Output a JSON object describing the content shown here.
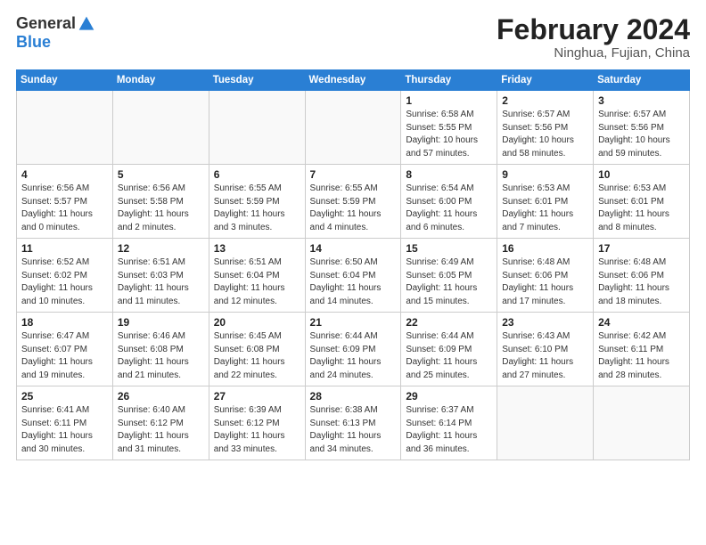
{
  "header": {
    "logo_general": "General",
    "logo_blue": "Blue",
    "main_title": "February 2024",
    "subtitle": "Ninghua, Fujian, China"
  },
  "weekdays": [
    "Sunday",
    "Monday",
    "Tuesday",
    "Wednesday",
    "Thursday",
    "Friday",
    "Saturday"
  ],
  "weeks": [
    [
      {
        "num": "",
        "info": ""
      },
      {
        "num": "",
        "info": ""
      },
      {
        "num": "",
        "info": ""
      },
      {
        "num": "",
        "info": ""
      },
      {
        "num": "1",
        "info": "Sunrise: 6:58 AM\nSunset: 5:55 PM\nDaylight: 10 hours\nand 57 minutes."
      },
      {
        "num": "2",
        "info": "Sunrise: 6:57 AM\nSunset: 5:56 PM\nDaylight: 10 hours\nand 58 minutes."
      },
      {
        "num": "3",
        "info": "Sunrise: 6:57 AM\nSunset: 5:56 PM\nDaylight: 10 hours\nand 59 minutes."
      }
    ],
    [
      {
        "num": "4",
        "info": "Sunrise: 6:56 AM\nSunset: 5:57 PM\nDaylight: 11 hours\nand 0 minutes."
      },
      {
        "num": "5",
        "info": "Sunrise: 6:56 AM\nSunset: 5:58 PM\nDaylight: 11 hours\nand 2 minutes."
      },
      {
        "num": "6",
        "info": "Sunrise: 6:55 AM\nSunset: 5:59 PM\nDaylight: 11 hours\nand 3 minutes."
      },
      {
        "num": "7",
        "info": "Sunrise: 6:55 AM\nSunset: 5:59 PM\nDaylight: 11 hours\nand 4 minutes."
      },
      {
        "num": "8",
        "info": "Sunrise: 6:54 AM\nSunset: 6:00 PM\nDaylight: 11 hours\nand 6 minutes."
      },
      {
        "num": "9",
        "info": "Sunrise: 6:53 AM\nSunset: 6:01 PM\nDaylight: 11 hours\nand 7 minutes."
      },
      {
        "num": "10",
        "info": "Sunrise: 6:53 AM\nSunset: 6:01 PM\nDaylight: 11 hours\nand 8 minutes."
      }
    ],
    [
      {
        "num": "11",
        "info": "Sunrise: 6:52 AM\nSunset: 6:02 PM\nDaylight: 11 hours\nand 10 minutes."
      },
      {
        "num": "12",
        "info": "Sunrise: 6:51 AM\nSunset: 6:03 PM\nDaylight: 11 hours\nand 11 minutes."
      },
      {
        "num": "13",
        "info": "Sunrise: 6:51 AM\nSunset: 6:04 PM\nDaylight: 11 hours\nand 12 minutes."
      },
      {
        "num": "14",
        "info": "Sunrise: 6:50 AM\nSunset: 6:04 PM\nDaylight: 11 hours\nand 14 minutes."
      },
      {
        "num": "15",
        "info": "Sunrise: 6:49 AM\nSunset: 6:05 PM\nDaylight: 11 hours\nand 15 minutes."
      },
      {
        "num": "16",
        "info": "Sunrise: 6:48 AM\nSunset: 6:06 PM\nDaylight: 11 hours\nand 17 minutes."
      },
      {
        "num": "17",
        "info": "Sunrise: 6:48 AM\nSunset: 6:06 PM\nDaylight: 11 hours\nand 18 minutes."
      }
    ],
    [
      {
        "num": "18",
        "info": "Sunrise: 6:47 AM\nSunset: 6:07 PM\nDaylight: 11 hours\nand 19 minutes."
      },
      {
        "num": "19",
        "info": "Sunrise: 6:46 AM\nSunset: 6:08 PM\nDaylight: 11 hours\nand 21 minutes."
      },
      {
        "num": "20",
        "info": "Sunrise: 6:45 AM\nSunset: 6:08 PM\nDaylight: 11 hours\nand 22 minutes."
      },
      {
        "num": "21",
        "info": "Sunrise: 6:44 AM\nSunset: 6:09 PM\nDaylight: 11 hours\nand 24 minutes."
      },
      {
        "num": "22",
        "info": "Sunrise: 6:44 AM\nSunset: 6:09 PM\nDaylight: 11 hours\nand 25 minutes."
      },
      {
        "num": "23",
        "info": "Sunrise: 6:43 AM\nSunset: 6:10 PM\nDaylight: 11 hours\nand 27 minutes."
      },
      {
        "num": "24",
        "info": "Sunrise: 6:42 AM\nSunset: 6:11 PM\nDaylight: 11 hours\nand 28 minutes."
      }
    ],
    [
      {
        "num": "25",
        "info": "Sunrise: 6:41 AM\nSunset: 6:11 PM\nDaylight: 11 hours\nand 30 minutes."
      },
      {
        "num": "26",
        "info": "Sunrise: 6:40 AM\nSunset: 6:12 PM\nDaylight: 11 hours\nand 31 minutes."
      },
      {
        "num": "27",
        "info": "Sunrise: 6:39 AM\nSunset: 6:12 PM\nDaylight: 11 hours\nand 33 minutes."
      },
      {
        "num": "28",
        "info": "Sunrise: 6:38 AM\nSunset: 6:13 PM\nDaylight: 11 hours\nand 34 minutes."
      },
      {
        "num": "29",
        "info": "Sunrise: 6:37 AM\nSunset: 6:14 PM\nDaylight: 11 hours\nand 36 minutes."
      },
      {
        "num": "",
        "info": ""
      },
      {
        "num": "",
        "info": ""
      }
    ]
  ]
}
